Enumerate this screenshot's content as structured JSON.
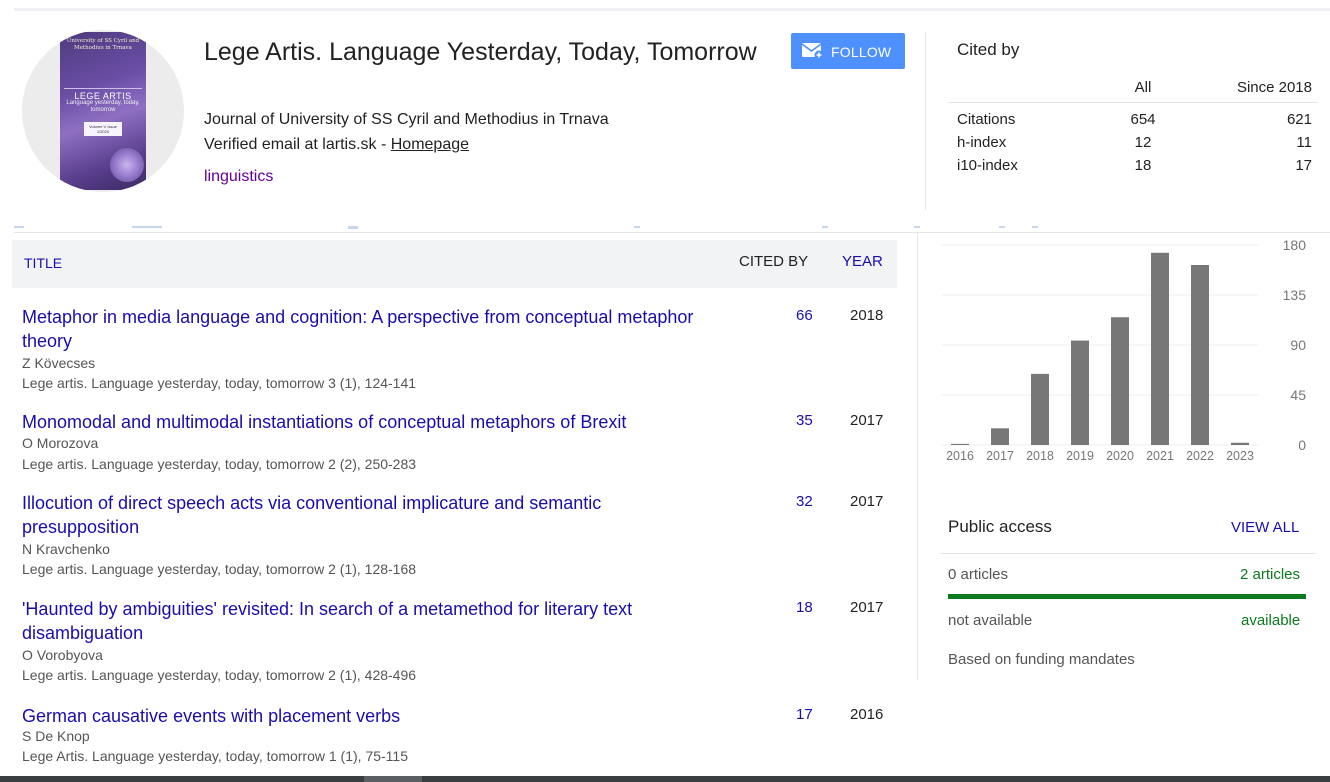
{
  "profile": {
    "name": "Lege Artis. Language Yesterday, Today, Tomorrow",
    "affiliation": "Journal of University of SS Cyril and Methodius in Trnava",
    "email_prefix": "Verified email at lartis.sk - ",
    "homepage_label": "Homepage",
    "interest": "linguistics",
    "follow_label": "FOLLOW",
    "cover": {
      "university": "University of SS Cyril and Methodius in Trnava",
      "title": "LEGE ARTIS",
      "subtitle": "Language yesterday, today, tomorrow",
      "volume": "Volume V Issue 1/2020"
    }
  },
  "cited_by": {
    "title": "Cited by",
    "columns": [
      "",
      "All",
      "Since 2018"
    ],
    "rows": [
      {
        "label": "Citations",
        "all": "654",
        "since": "621"
      },
      {
        "label": "h-index",
        "all": "12",
        "since": "11"
      },
      {
        "label": "i10-index",
        "all": "18",
        "since": "17"
      }
    ]
  },
  "articles_header": {
    "title": "TITLE",
    "cited_by": "CITED BY",
    "year": "YEAR"
  },
  "articles": [
    {
      "title": "Metaphor in media language and cognition: A perspective from conceptual metaphor theory",
      "authors": "Z Kövecses",
      "venue": "Lege artis. Language yesterday, today, tomorrow 3 (1), 124-141",
      "cited": "66",
      "year": "2018"
    },
    {
      "title": "Monomodal and multimodal instantiations of conceptual metaphors of Brexit",
      "authors": "O Morozova",
      "venue": "Lege artis. Language yesterday, today, tomorrow 2 (2), 250-283",
      "cited": "35",
      "year": "2017"
    },
    {
      "title": "Illocution of direct speech acts via conventional implicature and semantic presupposition",
      "authors": "N Kravchenko",
      "venue": "Lege artis. Language yesterday, today, tomorrow 2 (1), 128-168",
      "cited": "32",
      "year": "2017"
    },
    {
      "title": "'Haunted by ambiguities' revisited: In search of a metamethod for literary text disambiguation",
      "authors": "O Vorobyova",
      "venue": "Lege artis. Language yesterday, today, tomorrow 2 (1), 428-496",
      "cited": "18",
      "year": "2017"
    },
    {
      "title": "German causative events with placement verbs",
      "authors": "S De Knop",
      "venue": "Lege Artis. Language yesterday, today, tomorrow 1 (1), 75-115",
      "cited": "17",
      "year": "2016"
    }
  ],
  "chart_data": {
    "type": "bar",
    "categories": [
      "2016",
      "2017",
      "2018",
      "2019",
      "2020",
      "2021",
      "2022",
      "2023"
    ],
    "values": [
      1,
      15,
      64,
      94,
      115,
      173,
      162,
      2
    ],
    "ylim": [
      0,
      180
    ],
    "yticks": [
      0,
      45,
      90,
      135,
      180
    ],
    "bar_color": "#777777"
  },
  "public_access": {
    "title": "Public access",
    "view_all": "VIEW ALL",
    "not_available_count": "0 articles",
    "available_count": "2 articles",
    "not_available_label": "not available",
    "available_label": "available",
    "note": "Based on funding mandates",
    "available_fraction": 1.0,
    "color": "#0d7a20"
  }
}
